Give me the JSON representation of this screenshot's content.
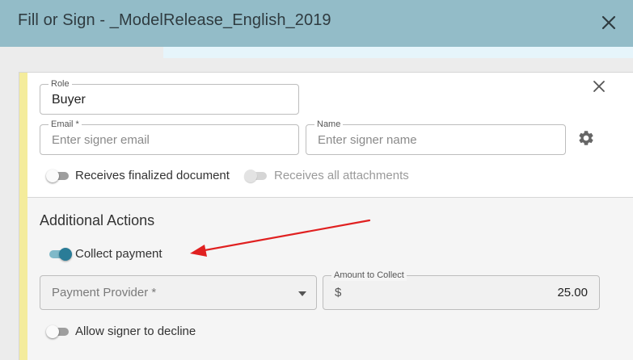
{
  "dialog": {
    "title": "Fill or Sign - _ModelRelease_English_2019"
  },
  "signer": {
    "role_label": "Role",
    "role_value": "Buyer",
    "email_label": "Email *",
    "email_placeholder": "Enter signer email",
    "name_label": "Name",
    "name_placeholder": "Enter signer name",
    "receives_finalized_label": "Receives finalized document",
    "receives_finalized_on": false,
    "receives_attachments_label": "Receives all attachments",
    "receives_attachments_on": false
  },
  "additional_actions": {
    "title": "Additional Actions",
    "collect_payment_label": "Collect payment",
    "collect_payment_on": true,
    "payment_provider_placeholder": "Payment Provider *",
    "amount_label": "Amount to Collect",
    "currency_symbol": "$",
    "amount_value": "25.00",
    "allow_decline_label": "Allow signer to decline",
    "allow_decline_on": false
  },
  "colors": {
    "title_bar": "#93bcc8",
    "accent": "#2a7c97",
    "signer_marker": "#f4ec9c",
    "annotation_arrow": "#e02020"
  },
  "icons": {
    "dialog_close": "close-icon",
    "signer_remove": "close-icon",
    "signer_settings": "gear-icon",
    "provider_dropdown": "caret-down-icon"
  }
}
